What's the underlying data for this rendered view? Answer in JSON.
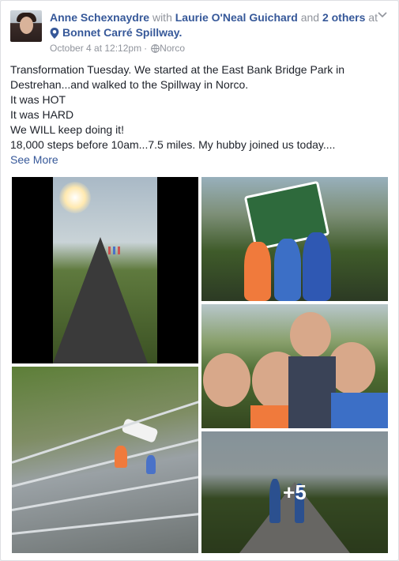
{
  "post": {
    "author": "Anne Schexnaydre",
    "with_word": "with",
    "tagged": "Laurie O'Neal Guichard",
    "and_word": "and",
    "others": "2 others",
    "at_word": "at",
    "location": "Bonnet Carré Spillway.",
    "timestamp": "October 4 at 12:12pm",
    "place_short": "Norco",
    "icons": {
      "location": "map-pin-icon",
      "audience": "globe-icon",
      "menu": "chevron-down-icon"
    },
    "lines": [
      "Transformation Tuesday. We started at the East Bank Bridge Park in Destrehan...and walked to the Spillway in Norco.",
      "It was HOT",
      "It was HARD",
      "We WILL keep doing it!",
      "18,000 steps before 10am...7.5 miles. My hubby joined us today...."
    ],
    "see_more": "See More",
    "photos_more_count": "+5"
  },
  "colors": {
    "link": "#365899",
    "text": "#1d2129",
    "meta": "#90949c"
  }
}
